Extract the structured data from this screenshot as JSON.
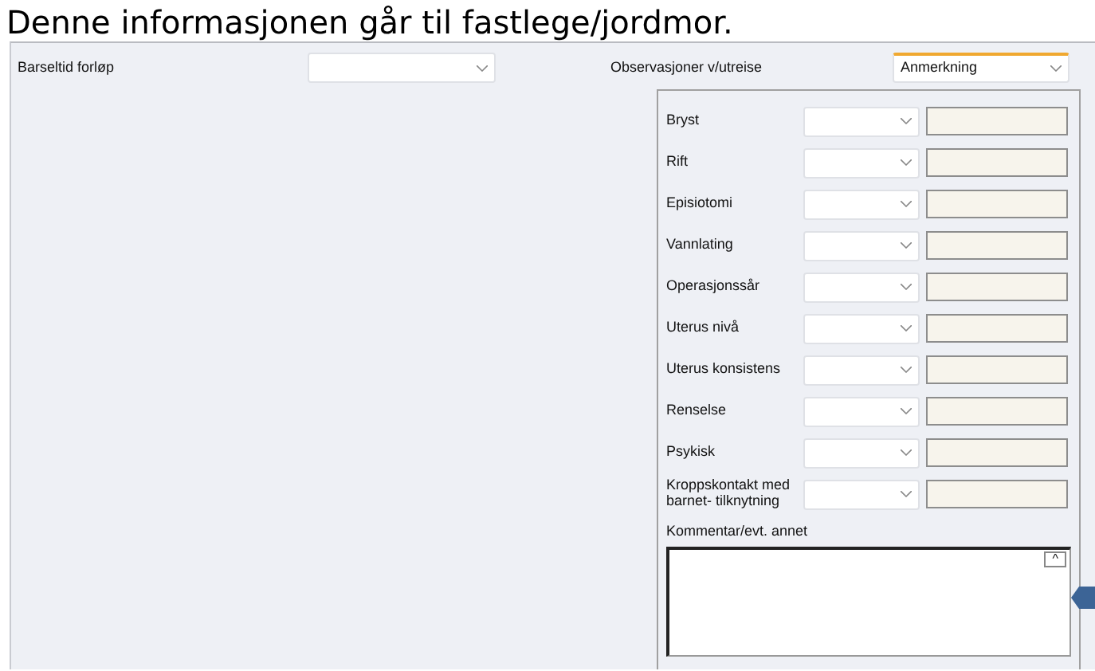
{
  "heading": "Denne informasjonen går til fastlege/jordmor.",
  "course": {
    "label": "Barseltid forløp"
  },
  "observations": {
    "label": "Observasjoner v/utreise",
    "value": "Anmerkning",
    "focused": true
  },
  "checks": [
    {
      "label": "Bryst"
    },
    {
      "label": "Rift"
    },
    {
      "label": "Episiotomi"
    },
    {
      "label": "Vannlating"
    },
    {
      "label": "Operasjonssår"
    },
    {
      "label": "Uterus nivå"
    },
    {
      "label": "Uterus konsistens"
    },
    {
      "label": "Renselse"
    },
    {
      "label": "Psykisk"
    },
    {
      "label": "Kroppskontakt med barnet- tilknytning"
    }
  ],
  "comment": {
    "label": "Kommentar/evt. annet",
    "scroll_button": "^"
  }
}
